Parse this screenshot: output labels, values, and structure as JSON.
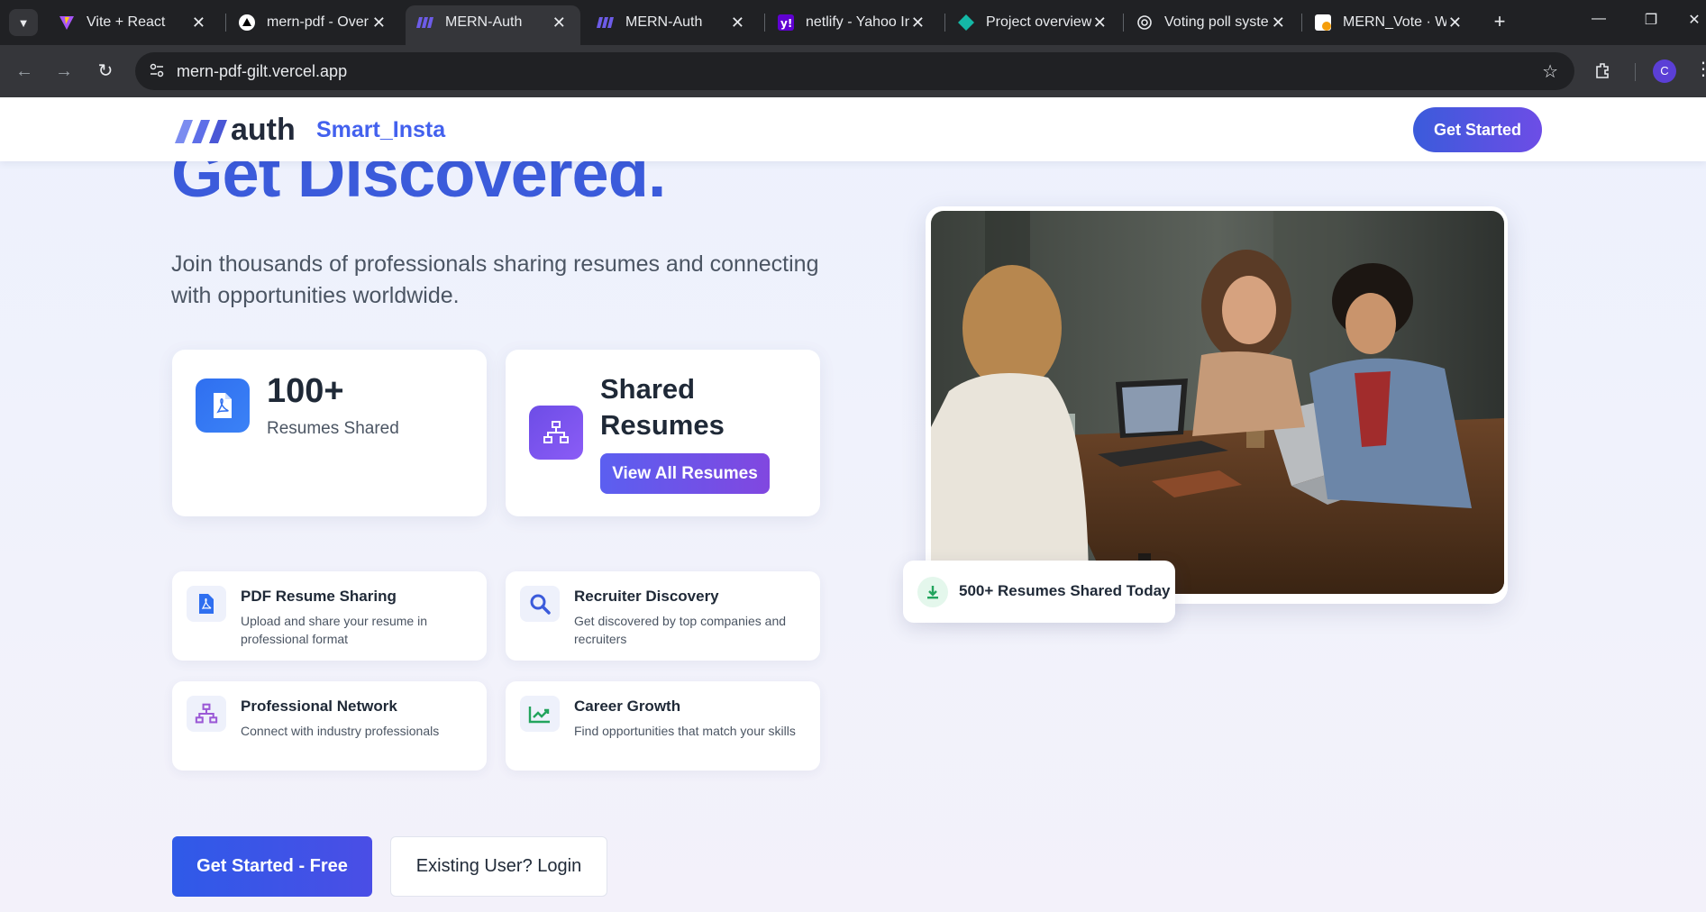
{
  "browser": {
    "tabs": [
      {
        "title": "Vite + React",
        "icon": "vite-icon"
      },
      {
        "title": "mern-pdf - Over",
        "icon": "vercel-icon"
      },
      {
        "title": "MERN-Auth",
        "icon": "mern-auth-icon",
        "active": true
      },
      {
        "title": "MERN-Auth",
        "icon": "mern-auth-icon"
      },
      {
        "title": "netlify - Yahoo In",
        "icon": "yahoo-icon"
      },
      {
        "title": "Project overview",
        "icon": "project-icon"
      },
      {
        "title": "Voting poll syste",
        "icon": "openai-icon"
      },
      {
        "title": "MERN_Vote · W",
        "icon": "w-icon"
      }
    ],
    "close_glyph": "✕",
    "new_tab_glyph": "+",
    "url": "mern-pdf-gilt.vercel.app",
    "profile_initial": "C"
  },
  "header": {
    "logo_text": "auth",
    "brand": "Smart_Insta",
    "cta": "Get Started"
  },
  "hero": {
    "title": "Get Discovered.",
    "subtitle": "Join thousands of professionals sharing resumes and connecting with opportunities worldwide."
  },
  "stats": {
    "count": "100+",
    "count_label": "Resumes Shared",
    "shared_title": "Shared Resumes",
    "view_all": "View All Resumes"
  },
  "features": [
    {
      "title": "PDF Resume Sharing",
      "desc": "Upload and share your resume in professional format",
      "icon": "pdf-icon"
    },
    {
      "title": "Recruiter Discovery",
      "desc": "Get discovered by top companies and recruiters",
      "icon": "search-icon"
    },
    {
      "title": "Professional Network",
      "desc": "Connect with industry professionals",
      "icon": "network-icon"
    },
    {
      "title": "Career Growth",
      "desc": "Find opportunities that match your skills",
      "icon": "growth-chart-icon"
    }
  ],
  "actions": {
    "primary": "Get Started - Free",
    "secondary": "Existing User? Login"
  },
  "badge": {
    "text": "500+ Resumes Shared Today",
    "icon": "download-icon"
  },
  "colors": {
    "accent": "#3b5bdb",
    "brand": "#4361ee",
    "purple": "#7c4ddf",
    "green": "#22a45d"
  }
}
